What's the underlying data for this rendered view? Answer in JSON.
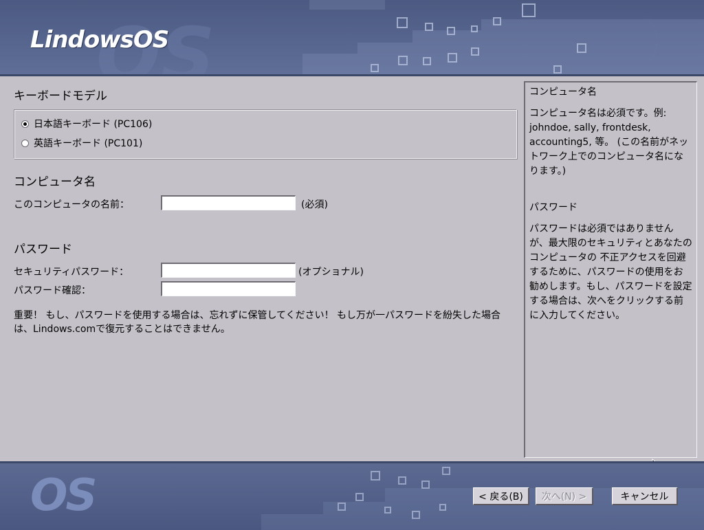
{
  "app": {
    "logo_text": "LindowsOS",
    "footer_logo_text": "OS"
  },
  "keyboard": {
    "title": "キーボードモデル",
    "options": [
      {
        "label": "日本語キーボード (PC106)",
        "selected": true
      },
      {
        "label": "英語キーボード (PC101)",
        "selected": false
      }
    ]
  },
  "computer": {
    "title": "コンピュータ名",
    "name_label": "このコンピュータの名前：",
    "name_value": "",
    "name_hint": "(必須)"
  },
  "password": {
    "title": "パスワード",
    "security_label": "セキュリティパスワード：",
    "security_value": "",
    "security_hint": "(オプショナル)",
    "confirm_label": "パスワード確認：",
    "confirm_value": ""
  },
  "warning_text": "重要！ もし、パスワードを使用する場合は、忘れずに保管してください！ もし万が一パスワードを紛失した場合は、Lindows.comで復元することはできません。",
  "help": {
    "computer_title": "コンピュータ名",
    "computer_text": "コンピュータ名は必須です。例: johndoe, sally, frontdesk, accounting5, 等。 (この名前がネットワーク上でのコンピュータ名になります。)",
    "password_title": "パスワード",
    "password_text": "パスワードは必須ではありませんが、最大限のセキュリティとあなたのコンピュータの 不正アクセスを回避するために、パスワードの使用をお勧めします。もし、パスワードを設定 する場合は、次へをクリックする前に入力してください。"
  },
  "buttons": {
    "back": "< 戻る(B)",
    "next": "次へ(N) >",
    "cancel": "キャンセル",
    "next_enabled": false
  },
  "colors": {
    "banner": "#56658e",
    "panel_bg": "#c4c2c8",
    "button_face": "#d6d4da"
  }
}
